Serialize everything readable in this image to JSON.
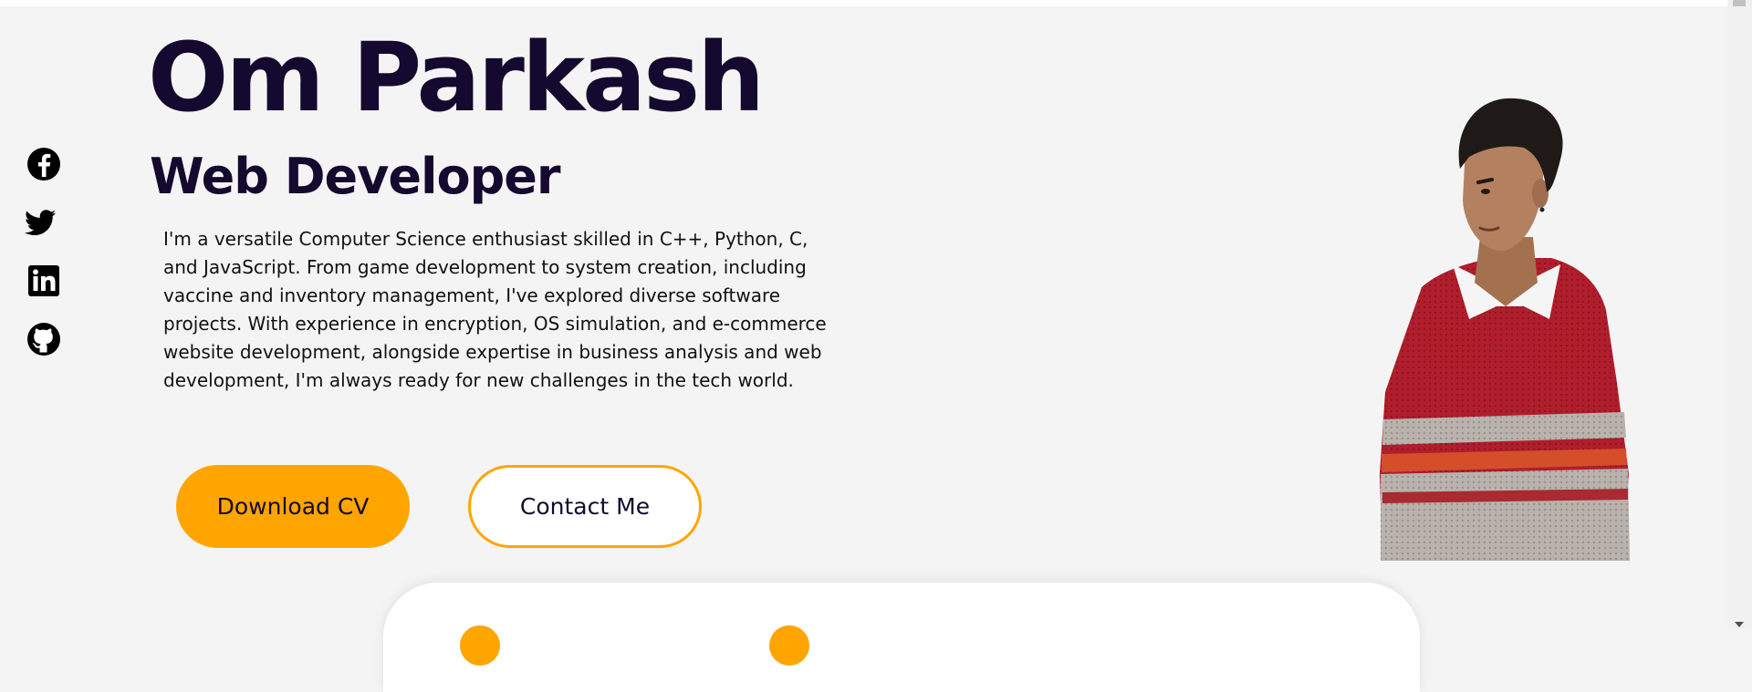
{
  "hero": {
    "name": "Om Parkash",
    "role": "Web Developer",
    "bio": "I'm a versatile Computer Science enthusiast skilled in C++, Python, C, and JavaScript. From game development to system creation, including vaccine and inventory management, I've explored diverse software projects. With experience in encryption, OS simulation, and e-commerce website development, alongside expertise in business analysis and web development, I'm always ready for new challenges in the tech world.",
    "download_label": "Download CV",
    "contact_label": "Contact Me"
  },
  "socials": [
    {
      "icon": "facebook-icon"
    },
    {
      "icon": "twitter-icon"
    },
    {
      "icon": "linkedin-icon"
    },
    {
      "icon": "github-icon"
    }
  ],
  "colors": {
    "background": "#f4f4f4",
    "text_dark": "#14092e",
    "accent": "#ffa500",
    "sweater_red": "#b01e2c",
    "sweater_grey": "#b9b2ad"
  }
}
